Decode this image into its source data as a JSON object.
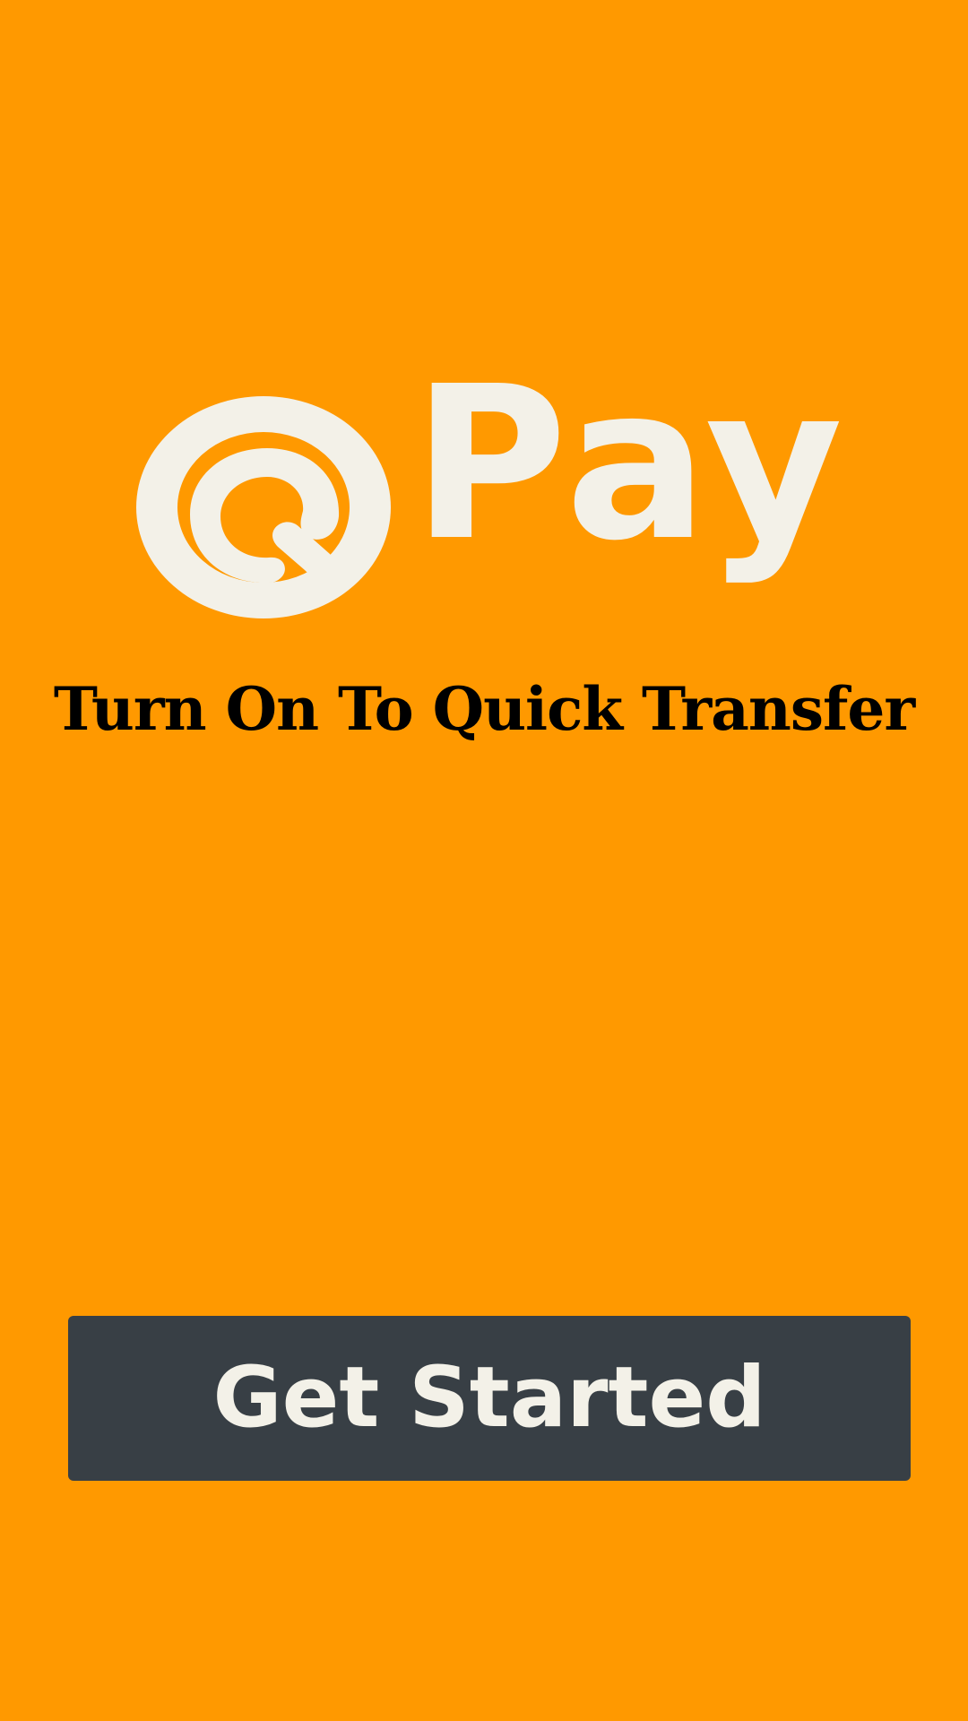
{
  "app": {
    "brand_letter": "Q",
    "brand_word": "Pay",
    "tagline": "Turn On To Quick Transfer"
  },
  "actions": {
    "get_started_label": "Get Started"
  },
  "icons": {
    "logo": "q-logo-icon"
  },
  "colors": {
    "background": "#FF9900",
    "logo": "#F3F1E8",
    "tagline": "#000000",
    "button_bg": "#383F45",
    "button_text": "#F3F1E8"
  }
}
